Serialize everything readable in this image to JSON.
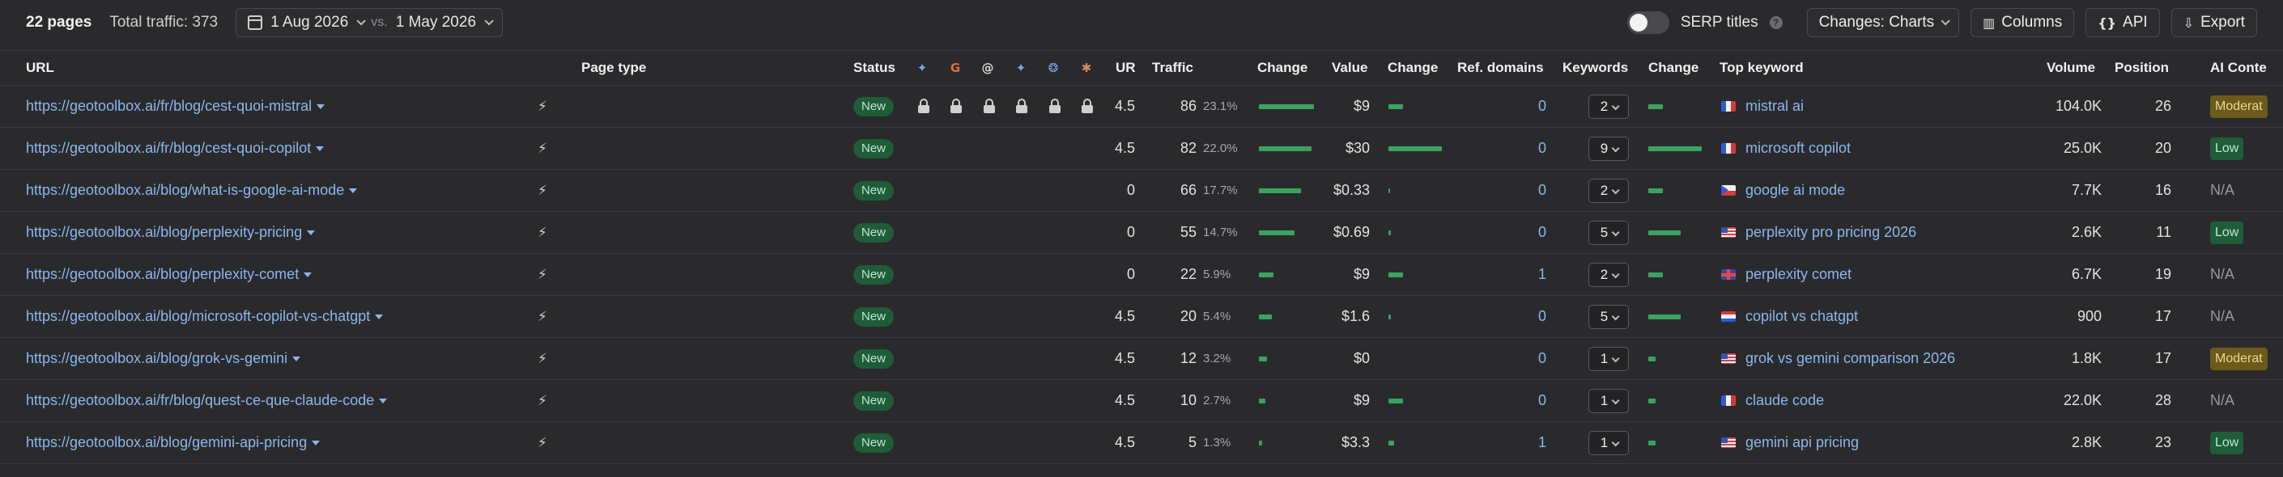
{
  "toolbar": {
    "pages": "22 pages",
    "total_traffic": "Total traffic: 373",
    "date_from": "1 Aug 2026",
    "vs": "vs.",
    "date_to": "1 May 2026",
    "serp_titles": "SERP titles",
    "changes_btn": "Changes: Charts",
    "columns_btn": "Columns",
    "api_btn": "API",
    "export_btn": "Export"
  },
  "columns": {
    "url": "URL",
    "page_type": "Page type",
    "status": "Status",
    "ur": "UR",
    "traffic": "Traffic",
    "change1": "Change",
    "value": "Value",
    "change2": "Change",
    "ref_domains": "Ref. domains",
    "keywords": "Keywords",
    "change3": "Change",
    "top_keyword": "Top keyword",
    "volume": "Volume",
    "position": "Position",
    "ai_content": "AI Conte"
  },
  "status_icons": [
    "sparkle-icon",
    "google-icon",
    "at-icon",
    "sparkle-icon",
    "openai-icon",
    "perplexity-icon"
  ],
  "rows": [
    {
      "url": "https://geotoolbox.ai/fr/blog/cest-quoi-mistral",
      "status": "New",
      "locks": true,
      "ur": "4.5",
      "traffic": "86",
      "traffic_pct": "23.1%",
      "traffic_bar": 1.0,
      "value": "$9",
      "value_bar": 0.28,
      "ref": "0",
      "keywords": "2",
      "kw_bar": 0.28,
      "flag": "fr",
      "top_keyword": "mistral ai",
      "volume": "104.0K",
      "position": "26",
      "ai": "Moderat",
      "ai_type": "mod"
    },
    {
      "url": "https://geotoolbox.ai/fr/blog/cest-quoi-copilot",
      "status": "New",
      "locks": false,
      "ur": "4.5",
      "traffic": "82",
      "traffic_pct": "22.0%",
      "traffic_bar": 0.95,
      "value": "$30",
      "value_bar": 1.0,
      "ref": "0",
      "keywords": "9",
      "kw_bar": 1.0,
      "flag": "fr",
      "top_keyword": "microsoft copilot",
      "volume": "25.0K",
      "position": "20",
      "ai": "Low",
      "ai_type": "low"
    },
    {
      "url": "https://geotoolbox.ai/blog/what-is-google-ai-mode",
      "status": "New",
      "locks": false,
      "ur": "0",
      "traffic": "66",
      "traffic_pct": "17.7%",
      "traffic_bar": 0.77,
      "value": "$0.33",
      "value_bar": 0.03,
      "ref": "0",
      "keywords": "2",
      "kw_bar": 0.28,
      "flag": "cz",
      "top_keyword": "google ai mode",
      "volume": "7.7K",
      "position": "16",
      "ai": "N/A",
      "ai_type": "na"
    },
    {
      "url": "https://geotoolbox.ai/blog/perplexity-pricing",
      "status": "New",
      "locks": false,
      "ur": "0",
      "traffic": "55",
      "traffic_pct": "14.7%",
      "traffic_bar": 0.64,
      "value": "$0.69",
      "value_bar": 0.04,
      "ref": "0",
      "keywords": "5",
      "kw_bar": 0.6,
      "flag": "us",
      "top_keyword": "perplexity pro pricing 2026",
      "volume": "2.6K",
      "position": "11",
      "ai": "Low",
      "ai_type": "low"
    },
    {
      "url": "https://geotoolbox.ai/blog/perplexity-comet",
      "status": "New",
      "locks": false,
      "ur": "0",
      "traffic": "22",
      "traffic_pct": "5.9%",
      "traffic_bar": 0.26,
      "value": "$9",
      "value_bar": 0.28,
      "ref": "1",
      "keywords": "2",
      "kw_bar": 0.28,
      "flag": "gb",
      "top_keyword": "perplexity comet",
      "volume": "6.7K",
      "position": "19",
      "ai": "N/A",
      "ai_type": "na"
    },
    {
      "url": "https://geotoolbox.ai/blog/microsoft-copilot-vs-chatgpt",
      "status": "New",
      "locks": false,
      "ur": "4.5",
      "traffic": "20",
      "traffic_pct": "5.4%",
      "traffic_bar": 0.23,
      "value": "$1.6",
      "value_bar": 0.05,
      "ref": "0",
      "keywords": "5",
      "kw_bar": 0.6,
      "flag": "nl",
      "top_keyword": "copilot vs chatgpt",
      "volume": "900",
      "position": "17",
      "ai": "N/A",
      "ai_type": "na"
    },
    {
      "url": "https://geotoolbox.ai/blog/grok-vs-gemini",
      "status": "New",
      "locks": false,
      "ur": "4.5",
      "traffic": "12",
      "traffic_pct": "3.2%",
      "traffic_bar": 0.14,
      "value": "$0",
      "value_bar": 0.0,
      "ref": "0",
      "keywords": "1",
      "kw_bar": 0.14,
      "flag": "us",
      "top_keyword": "grok vs gemini comparison 2026",
      "volume": "1.8K",
      "position": "17",
      "ai": "Moderat",
      "ai_type": "mod"
    },
    {
      "url": "https://geotoolbox.ai/fr/blog/quest-ce-que-claude-code",
      "status": "New",
      "locks": false,
      "ur": "4.5",
      "traffic": "10",
      "traffic_pct": "2.7%",
      "traffic_bar": 0.12,
      "value": "$9",
      "value_bar": 0.28,
      "ref": "0",
      "keywords": "1",
      "kw_bar": 0.14,
      "flag": "fr",
      "top_keyword": "claude code",
      "volume": "22.0K",
      "position": "28",
      "ai": "N/A",
      "ai_type": "na"
    },
    {
      "url": "https://geotoolbox.ai/blog/gemini-api-pricing",
      "status": "New",
      "locks": false,
      "ur": "4.5",
      "traffic": "5",
      "traffic_pct": "1.3%",
      "traffic_bar": 0.06,
      "value": "$3.3",
      "value_bar": 0.1,
      "ref": "1",
      "keywords": "1",
      "kw_bar": 0.14,
      "flag": "us",
      "top_keyword": "gemini api pricing",
      "volume": "2.8K",
      "position": "23",
      "ai": "Low",
      "ai_type": "low"
    }
  ]
}
